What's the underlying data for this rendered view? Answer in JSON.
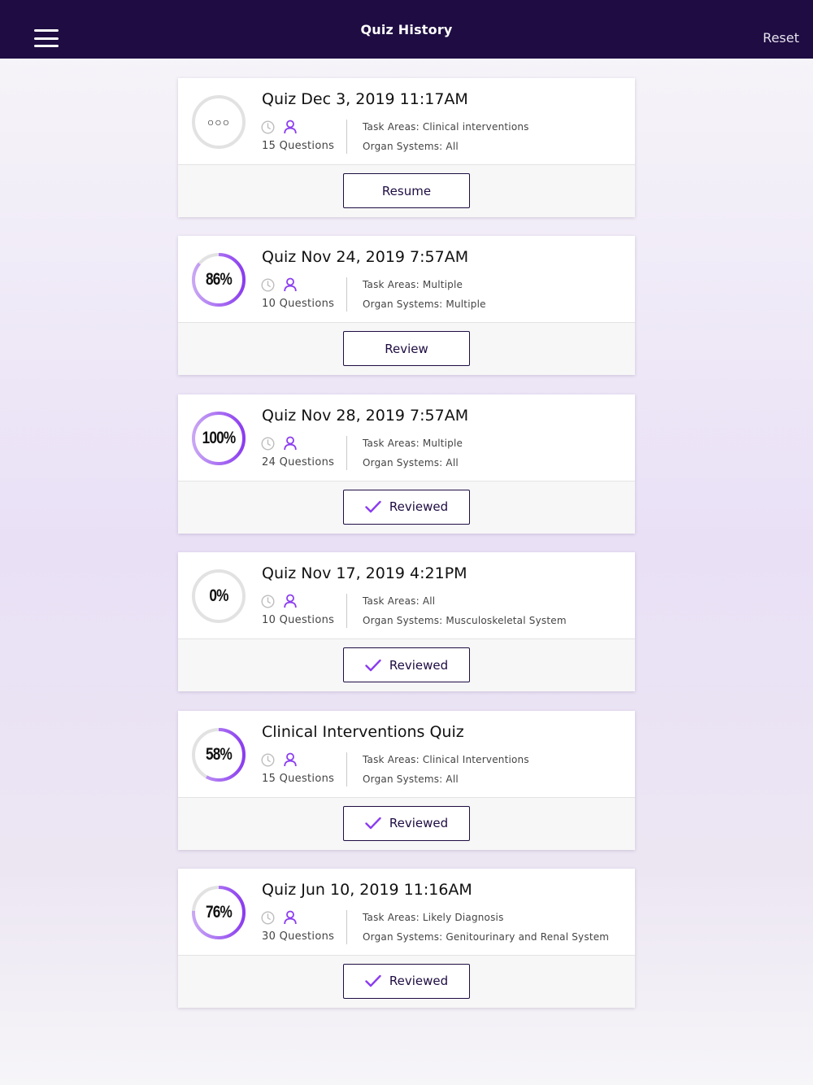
{
  "header": {
    "title": "Quiz History",
    "reset_label": "Reset"
  },
  "colors": {
    "header_bg": "#1e0c42",
    "accent": "#8b3cf0",
    "ring_track": "#e2e2e2",
    "button_border": "#1e0c42"
  },
  "quizzes": [
    {
      "title": "Quiz Dec 3, 2019 11:17AM",
      "score_label": "○○○",
      "progress": 0,
      "in_progress": true,
      "questions": "15 Questions",
      "task_areas": "Task Areas: Clinical interventions",
      "organ_systems": "Organ Systems: All",
      "action_label": "Resume",
      "action_icon": "none"
    },
    {
      "title": "Quiz Nov 24, 2019 7:57AM",
      "score_label": "86%",
      "progress": 0.86,
      "in_progress": false,
      "questions": "10 Questions",
      "task_areas": "Task Areas: Multiple",
      "organ_systems": "Organ Systems: Multiple",
      "action_label": "Review",
      "action_icon": "none"
    },
    {
      "title": "Quiz Nov 28, 2019 7:57AM",
      "score_label": "100%",
      "progress": 1.0,
      "in_progress": false,
      "questions": "24 Questions",
      "task_areas": "Task Areas: Multiple",
      "organ_systems": "Organ Systems: All",
      "action_label": "Reviewed",
      "action_icon": "check-icon"
    },
    {
      "title": "Quiz Nov 17, 2019 4:21PM",
      "score_label": "0%",
      "progress": 0,
      "in_progress": false,
      "questions": "10 Questions",
      "task_areas": "Task Areas: All",
      "organ_systems": "Organ Systems:  Musculoskeletal System",
      "action_label": "Reviewed",
      "action_icon": "check-icon"
    },
    {
      "title": "Clinical Interventions Quiz",
      "score_label": "58%",
      "progress": 0.58,
      "in_progress": false,
      "questions": "15 Questions",
      "task_areas": "Task Areas: Clinical Interventions",
      "organ_systems": "Organ Systems: All",
      "action_label": "Reviewed",
      "action_icon": "check-icon"
    },
    {
      "title": "Quiz Jun 10, 2019 11:16AM",
      "score_label": "76%",
      "progress": 0.76,
      "in_progress": false,
      "questions": "30 Questions",
      "task_areas": "Task Areas:  Likely Diagnosis",
      "organ_systems": "Organ Systems:  Genitourinary and Renal System",
      "action_label": "Reviewed",
      "action_icon": "check-icon"
    }
  ]
}
